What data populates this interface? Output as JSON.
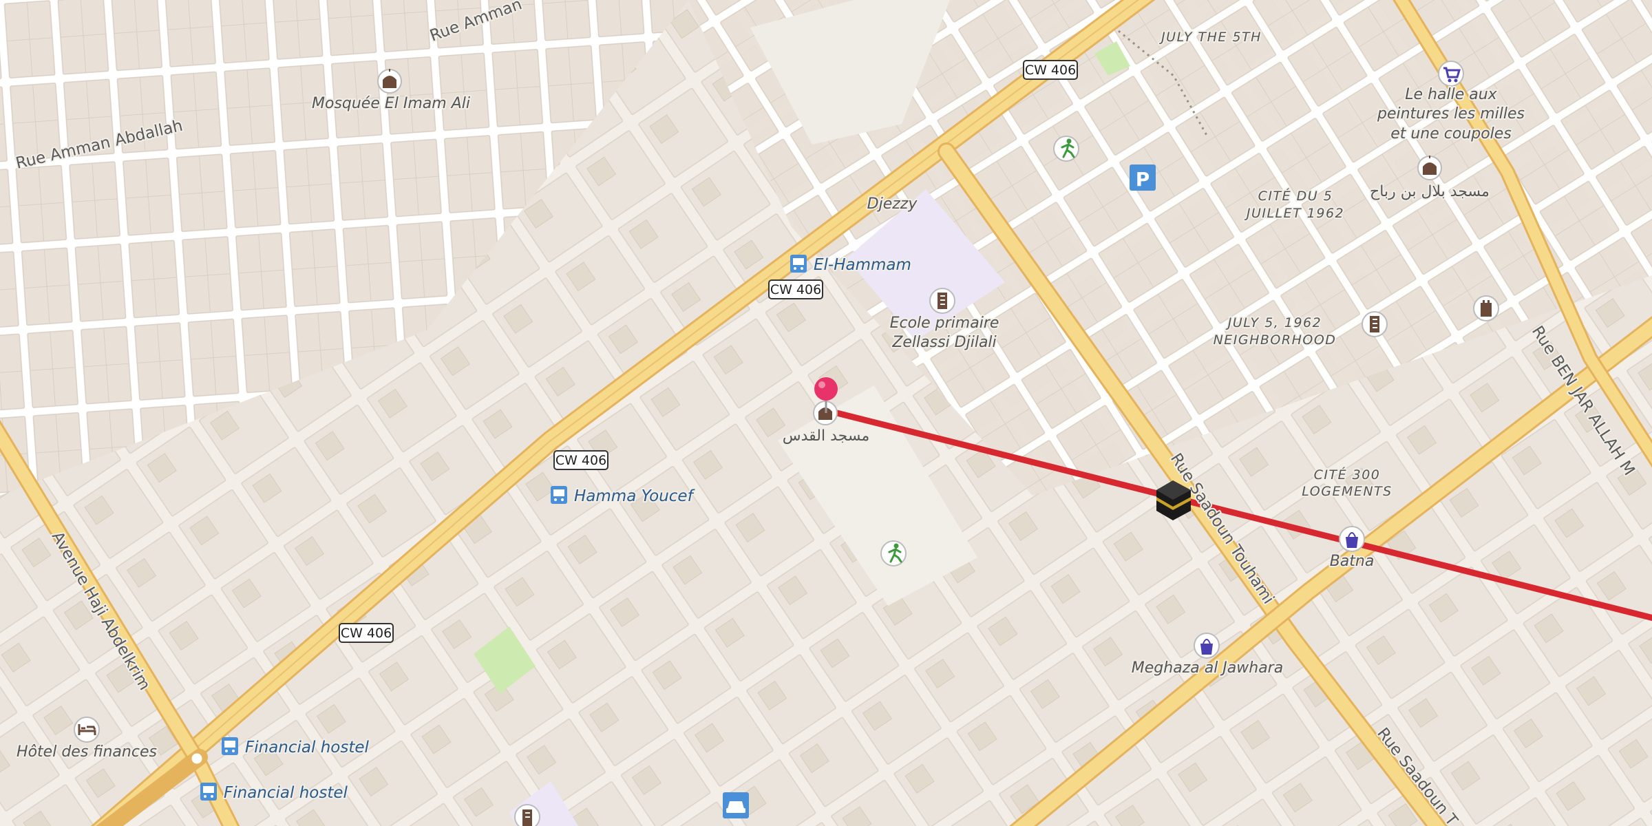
{
  "map": {
    "route_color": "#d7282f",
    "pin_color": "#e8336a",
    "road_major_color": "#f7d98a",
    "road_casing_color": "#e4b35c",
    "park_color": "#cdebb0",
    "school_area_color": "#ece6f7",
    "block_color": "#e8dfd5",
    "street_color": "#ffffff"
  },
  "streets": {
    "rue_amman_abdallah": "Rue Amman Abdallah",
    "rue_amman_top": "Rue Amman",
    "avenue_hadj": "Avenue Haji Abdelkrim",
    "rue_saadoun_1": "Rue Saadoun Touhami",
    "rue_saadoun_2": "Rue Saadoun T",
    "rue_ben": "Rue BEN JAR ALLAH M"
  },
  "shields": {
    "cw1": "CW 406",
    "cw2": "CW 406",
    "cw3": "CW 406",
    "cw4": "CW 406"
  },
  "neighborhoods": {
    "july5_top": "JULY THE 5TH",
    "cite_5_l1": "CITÉ DU 5",
    "cite_5_l2": "JUILLET 1962",
    "july5_1962_l1": "JULY 5, 1962",
    "july5_1962_l2": "NEIGHBORHOOD",
    "cite_300_l1": "CITÉ 300",
    "cite_300_l2": "LOGEMENTS"
  },
  "pois": {
    "mosquee_imam_ali": "Mosquée El Imam Ali",
    "halle_l1": "Le halle aux",
    "halle_l2": "peintures les milles",
    "halle_l3": "et une coupoles",
    "masjid_bilal": "مسجد بلال بن رباح",
    "djezzy": "Djezzy",
    "el_hammam": "El-Hammam",
    "ecole_l1": "Ecole primaire",
    "ecole_l2": "Zellassi Djilali",
    "masjid_alquds": "مسجد القدس",
    "hamma_youcef": "Hamma Youcef",
    "batna": "Batna",
    "meghaza": "Meghaza al Jawhara",
    "hotel_finances": "Hôtel des finances",
    "financial_hostel_1": "Financial hostel",
    "financial_hostel_2": "Financial hostel"
  },
  "icons": {
    "parking": "P"
  }
}
